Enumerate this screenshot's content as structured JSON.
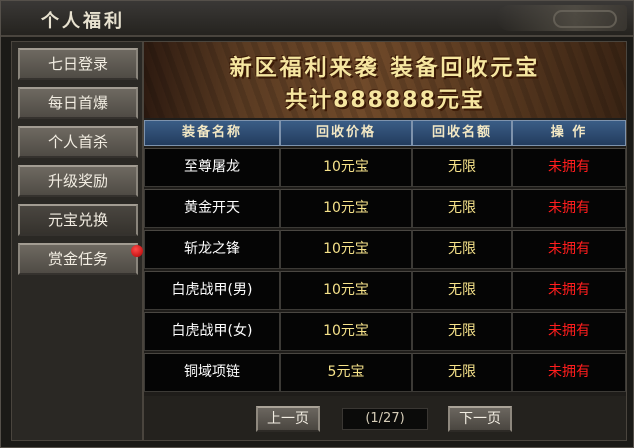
{
  "window": {
    "title": "个人福利"
  },
  "sidebar": {
    "tabs": [
      {
        "label": "七日登录"
      },
      {
        "label": "每日首爆"
      },
      {
        "label": "个人首杀"
      },
      {
        "label": "升级奖励"
      },
      {
        "label": "元宝兑换"
      },
      {
        "label": "赏金任务"
      }
    ],
    "active_index": 4,
    "badge_tab_index": 5
  },
  "banner": {
    "line1": "新区福利来袭 装备回收元宝",
    "line2": "共计888888元宝"
  },
  "table": {
    "headers": [
      "装备名称",
      "回收价格",
      "回收名额",
      "操 作"
    ],
    "rows": [
      {
        "name": "至尊屠龙",
        "price": "10元宝",
        "limit": "无限",
        "op": "未拥有"
      },
      {
        "name": "黄金开天",
        "price": "10元宝",
        "limit": "无限",
        "op": "未拥有"
      },
      {
        "name": "斩龙之锋",
        "price": "10元宝",
        "limit": "无限",
        "op": "未拥有"
      },
      {
        "name": "白虎战甲(男)",
        "price": "10元宝",
        "limit": "无限",
        "op": "未拥有"
      },
      {
        "name": "白虎战甲(女)",
        "price": "10元宝",
        "limit": "无限",
        "op": "未拥有"
      },
      {
        "name": "铜域项链",
        "price": "5元宝",
        "limit": "无限",
        "op": "未拥有"
      }
    ]
  },
  "pager": {
    "prev_label": "上一页",
    "page_info": "(1/27)",
    "next_label": "下一页"
  },
  "colors": {
    "header_blue": "#2c4a70",
    "price_yellow": "#f6e28a",
    "op_red": "#ff1d1d",
    "badge_red": "#d00000"
  }
}
